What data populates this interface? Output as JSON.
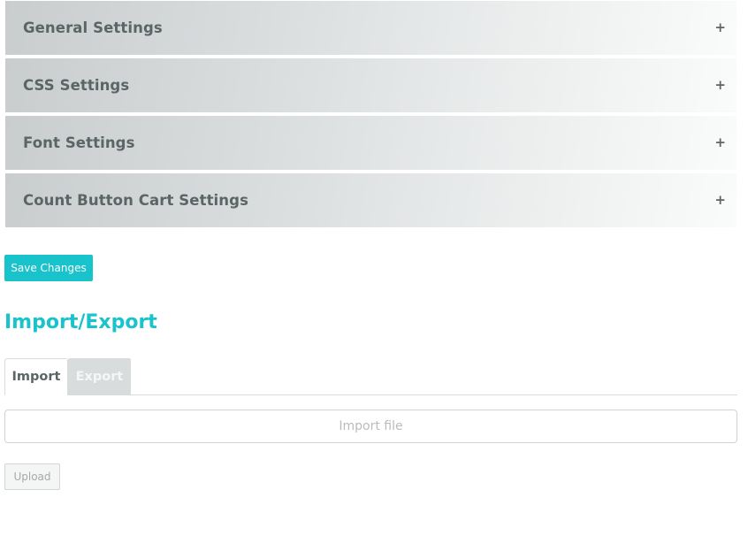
{
  "accordion": {
    "sections": [
      {
        "title": "General Settings",
        "toggle": "+"
      },
      {
        "title": "CSS Settings",
        "toggle": "+"
      },
      {
        "title": "Font Settings",
        "toggle": "+"
      },
      {
        "title": "Count Button Cart Settings",
        "toggle": "+"
      }
    ]
  },
  "actions": {
    "save_label": "Save Changes"
  },
  "import_export": {
    "heading": "Import/Export",
    "tabs": [
      {
        "label": "Import",
        "active": true
      },
      {
        "label": "Export",
        "active": false
      }
    ],
    "file_input": {
      "placeholder": "Import file",
      "value": ""
    },
    "upload_label": "Upload"
  },
  "colors": {
    "accent": "#19c3cb",
    "panel_text": "#5b6565",
    "inactive_tab_bg": "#d9dcdd"
  }
}
